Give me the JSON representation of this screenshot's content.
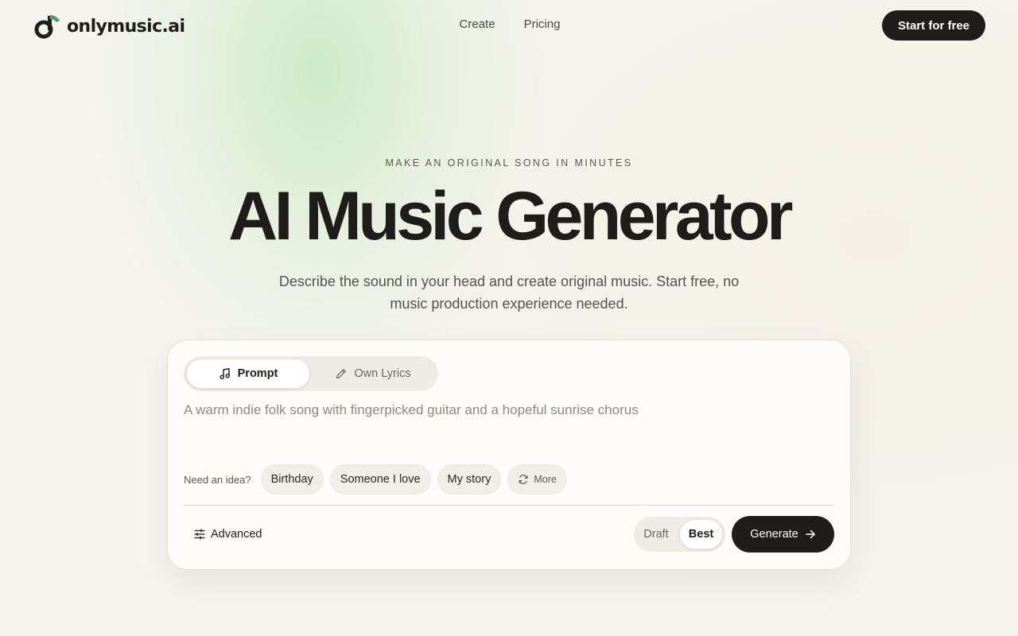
{
  "header": {
    "brand": "onlymusic.ai",
    "nav": [
      {
        "label": "Create"
      },
      {
        "label": "Pricing"
      }
    ],
    "cta_label": "Start for free"
  },
  "hero": {
    "eyebrow": "MAKE AN ORIGINAL SONG IN MINUTES",
    "title": "AI Music Generator",
    "subtitle": "Describe the sound in your head and create original music. Start free, no music production experience needed."
  },
  "composer": {
    "tabs": [
      {
        "label": "Prompt",
        "icon": "music-note-icon",
        "active": true
      },
      {
        "label": "Own Lyrics",
        "icon": "pencil-icon",
        "active": false
      }
    ],
    "prompt": {
      "value": "",
      "placeholder": "A warm indie folk song with fingerpicked guitar and a hopeful sunrise chorus"
    },
    "ideas_label": "Need an idea?",
    "ideas": [
      {
        "label": "Birthday"
      },
      {
        "label": "Someone I love"
      },
      {
        "label": "My story"
      }
    ],
    "more_label": "More",
    "advanced_label": "Advanced",
    "quality": {
      "options": [
        "Draft",
        "Best"
      ],
      "selected": "Best"
    },
    "generate_label": "Generate"
  },
  "colors": {
    "accent_dark": "#1f1d1a",
    "brand_green": "#4f9a5d",
    "background": "#f6f4ef"
  }
}
